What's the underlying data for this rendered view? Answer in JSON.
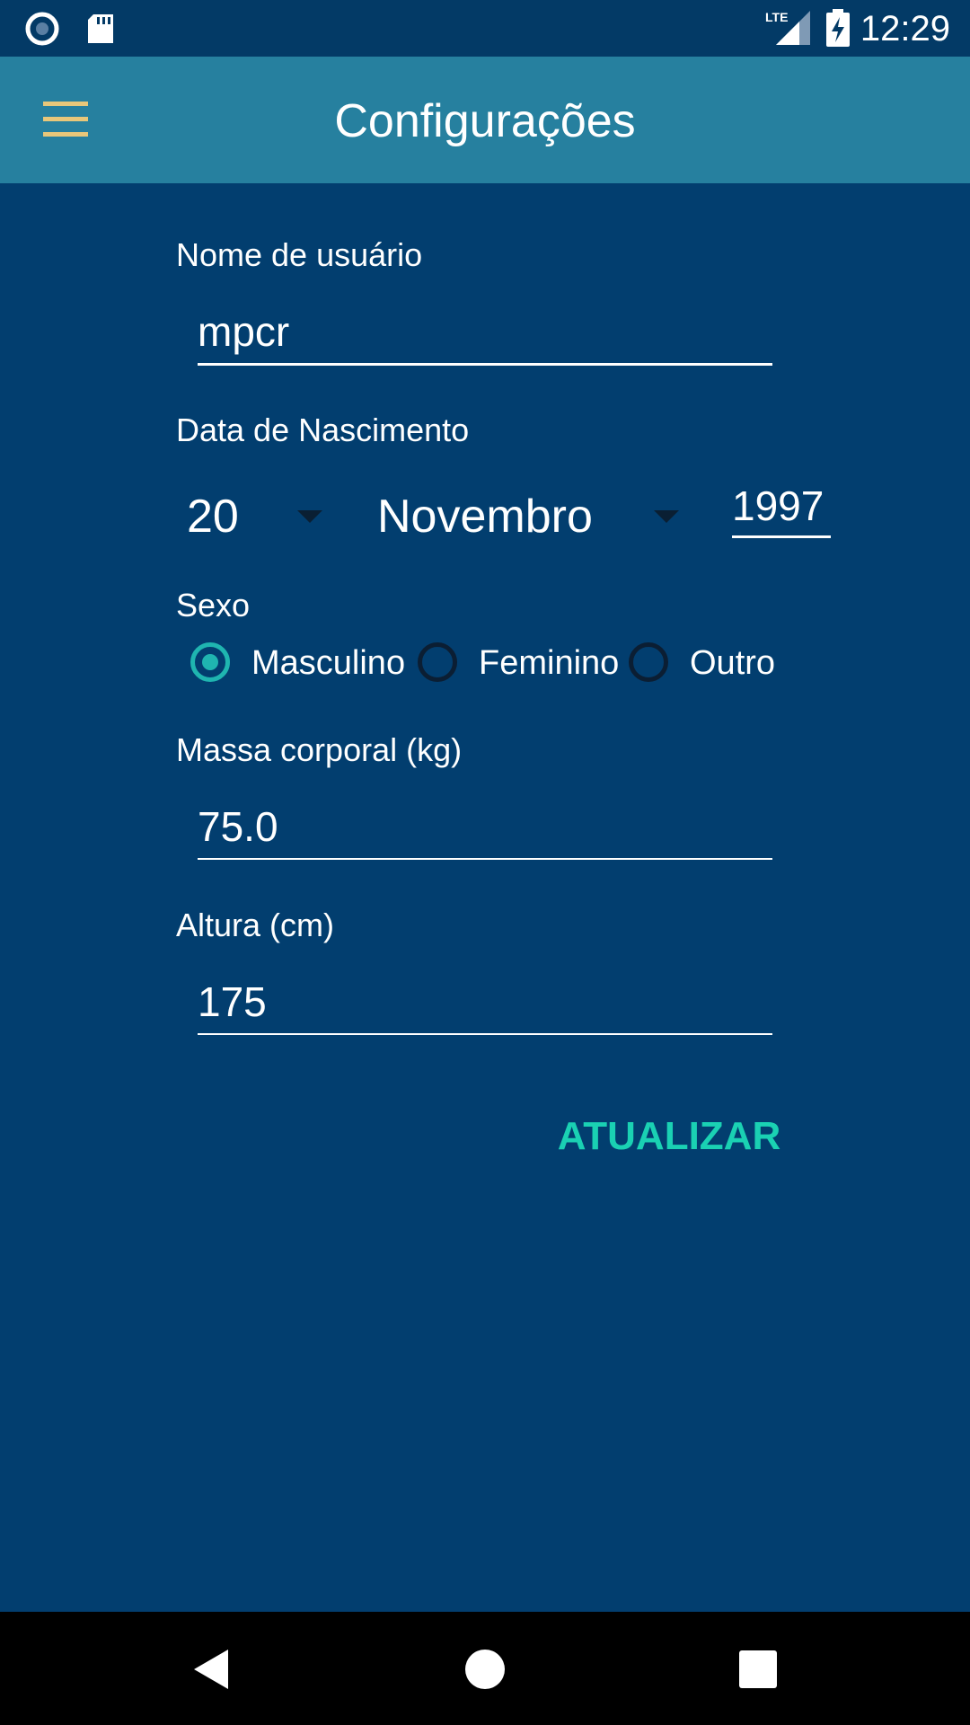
{
  "status_bar": {
    "time": "12:29",
    "network": "LTE",
    "icons": [
      "record-icon",
      "sd-card-icon",
      "signal-icon",
      "battery-charging-icon"
    ]
  },
  "app_bar": {
    "title": "Configurações",
    "menu_icon": "hamburger-menu-icon",
    "menu_icon_color": "#e8c77a",
    "background": "#26809f"
  },
  "form": {
    "username": {
      "label": "Nome de usuário",
      "value": "mpcr"
    },
    "birth_date": {
      "label": "Data de Nascimento",
      "day": "20",
      "month": "Novembro",
      "year": "1997"
    },
    "sex": {
      "label": "Sexo",
      "options": [
        "Masculino",
        "Feminino",
        "Outro"
      ],
      "selected": "Masculino"
    },
    "weight": {
      "label": "Massa corporal (kg)",
      "value": "75.0"
    },
    "height": {
      "label": "Altura (cm)",
      "value": "175"
    },
    "update_button": "ATUALIZAR"
  },
  "colors": {
    "background": "#023e6f",
    "accent": "#1fb5b0",
    "button_text": "#1ad1b3"
  },
  "nav_bar": {
    "buttons": [
      "back-icon",
      "home-icon",
      "recents-icon"
    ]
  }
}
